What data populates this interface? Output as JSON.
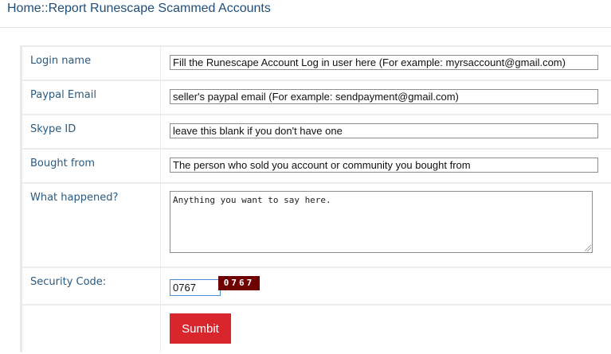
{
  "header": {
    "breadcrumb": "Home::Report Runescape Scammed Accounts"
  },
  "form": {
    "login_name": {
      "label": "Login name",
      "value": "Fill the Runescape Account Log in user here (For example: myrsaccount@gmail.com)"
    },
    "paypal_email": {
      "label": "Paypal Email",
      "value": "seller's paypal email (For example: sendpayment@gmail.com)"
    },
    "skype_id": {
      "label": "Skype ID",
      "value": "leave this blank if you don't have one"
    },
    "bought_from": {
      "label": "Bought from",
      "value": "The person who sold you account or community you bought from"
    },
    "what_happened": {
      "label": "What happened?",
      "value": "Anything you want to say here."
    },
    "security_code": {
      "label": "Security Code:",
      "value": "0767",
      "captcha_text": "0767",
      "captcha_color": "#6e0000"
    },
    "submit_label": "Sumbit",
    "submit_color": "#d9262c"
  }
}
